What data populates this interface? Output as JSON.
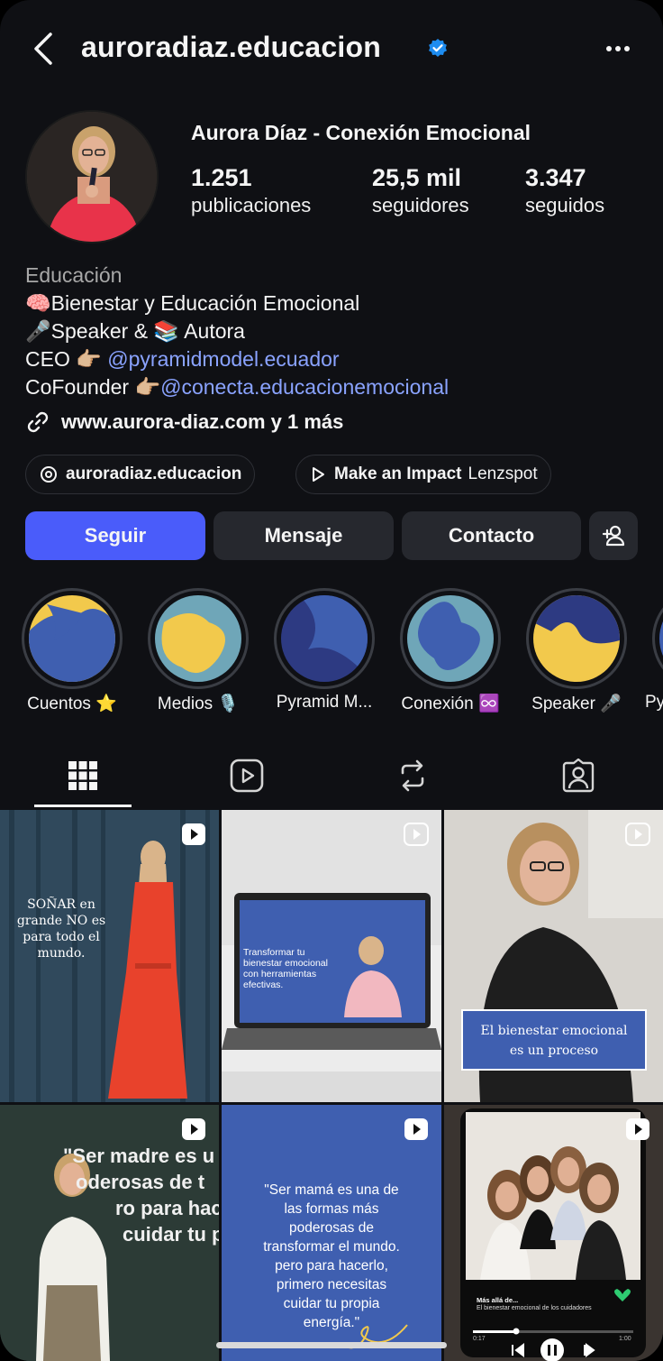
{
  "header": {
    "username": "auroradiaz.educacion"
  },
  "profile": {
    "display_name": "Aurora Díaz - Conexión Emocional",
    "stats": [
      {
        "value": "1.251",
        "label": "publicaciones"
      },
      {
        "value": "25,5 mil",
        "label": "seguidores"
      },
      {
        "value": "3.347",
        "label": "seguidos"
      }
    ],
    "category": "Educación",
    "bio_lines": [
      "🧠Bienestar y Educación Emocional",
      "🎤Speaker & 📚 Autora"
    ],
    "ceo_prefix": "CEO 👉🏼 ",
    "ceo_mention": "@pyramidmodel.ecuador",
    "cofounder_prefix": "CoFounder 👉🏼",
    "cofounder_mention": "@conecta.educacionemocional",
    "link": "www.aurora-diaz.com y 1 más"
  },
  "chips": [
    {
      "label": "auroradiaz.educacion",
      "sub": ""
    },
    {
      "label": "Make an Impact",
      "sub": "Lenzspot"
    }
  ],
  "actions": {
    "follow": "Seguir",
    "message": "Mensaje",
    "contact": "Contacto"
  },
  "highlights": [
    {
      "label": "Cuentos ⭐"
    },
    {
      "label": "Medios 🎙️"
    },
    {
      "label": "Pyramid M..."
    },
    {
      "label": "Conexión ♾️"
    },
    {
      "label": "Speaker 🎤"
    },
    {
      "label": "Py"
    }
  ],
  "posts": {
    "p1_text": [
      "SOÑAR en",
      "grande NO es",
      "para todo el",
      "mundo."
    ],
    "p2_line1": "Transformar tu",
    "p2_line2": "bienestar emocional",
    "p2_line3": "con herramientas",
    "p2_line4": "efectivas.",
    "p3_line1": "El bienestar emocional",
    "p3_line2": "es un proceso",
    "p4_lines": [
      "\"Ser madre es u",
      "oderosas de t",
      "ro para hace",
      "cuidar tu p"
    ],
    "p5_lines": [
      "\"Ser mamá es una de",
      "las formas más",
      "poderosas de",
      "transformar el mundo.",
      "pero para hacerlo,",
      "primero necesitas",
      "cuidar tu propia",
      "energía.\""
    ],
    "p6_title": "Más allá de...",
    "p6_sub": "El bienestar emocional de los cuidadores",
    "p6_time_start": "0:17",
    "p6_time_end": "1:00"
  },
  "colors": {
    "accent": "#4a5cfa",
    "mention": "#8aa3ff",
    "brand_blue": "#3f5fb0",
    "brand_yellow": "#f2c94c"
  }
}
